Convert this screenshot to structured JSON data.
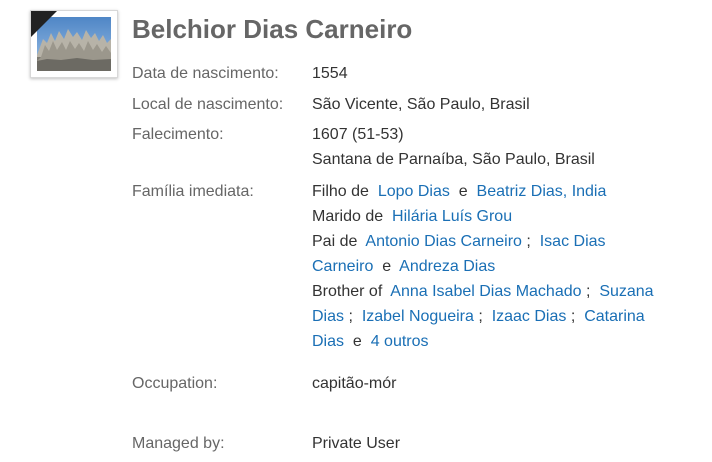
{
  "profile": {
    "name": "Belchior Dias Carneiro",
    "photo_icon": "monument-photo",
    "ribbon_icon": "mourning-ribbon-icon"
  },
  "fields": {
    "birth_date": {
      "label": "Data de nascimento:",
      "value": "1554"
    },
    "birth_place": {
      "label": "Local de nascimento:",
      "value": "São Vicente, São Paulo, Brasil"
    },
    "death": {
      "label": "Falecimento:",
      "value": "1607 (51-53)",
      "place": "Santana de Parnaíba, São Paulo, Brasil"
    },
    "family": {
      "label": "Família imediata:"
    },
    "occupation": {
      "label": "Occupation:",
      "value": "capitão-mór"
    },
    "managed_by": {
      "label": "Managed by:",
      "value": "Private User"
    }
  },
  "family": {
    "son_of_prefix": "Filho de",
    "father": "Lopo Dias",
    "and_1": "e",
    "mother": "Beatriz Dias, India",
    "husband_prefix": "Marido de",
    "wife": "Hilária Luís Grou",
    "father_prefix": "Pai de",
    "children": [
      "Antonio Dias Carneiro",
      "Isac Dias",
      "Carneiro",
      "Andreza Dias"
    ],
    "semicolon": ";",
    "and_2": "e",
    "brother_prefix": "Brother of",
    "siblings": [
      "Anna Isabel Dias Machado",
      "Suzana",
      "Dias",
      "Izabel Nogueira",
      "Izaac Dias",
      "Catarina",
      "Dias"
    ],
    "and_3": "e",
    "more_link": "4 outros"
  },
  "colors": {
    "label": "#666666",
    "text": "#333333",
    "link": "#1a6fb5"
  }
}
